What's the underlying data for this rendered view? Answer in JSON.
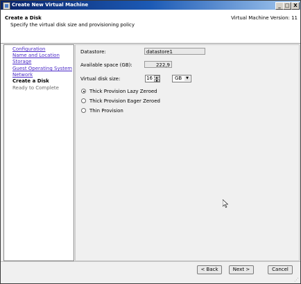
{
  "window": {
    "title": "Create New Virtual Machine",
    "controls": {
      "minimize": "_",
      "maximize": "□",
      "close": "X"
    }
  },
  "header": {
    "title": "Create a Disk",
    "subtitle": "Specify the virtual disk size and provisioning policy",
    "version": "Virtual Machine Version: 11"
  },
  "sidebar": {
    "steps": [
      {
        "label": "Configuration",
        "state": "link"
      },
      {
        "label": "Name and Location",
        "state": "link"
      },
      {
        "label": "Storage",
        "state": "link"
      },
      {
        "label": "Guest Operating System",
        "state": "link"
      },
      {
        "label": "Network",
        "state": "link"
      },
      {
        "label": "Create a Disk",
        "state": "current"
      },
      {
        "label": "Ready to Complete",
        "state": "pending"
      }
    ]
  },
  "form": {
    "datastore_label": "Datastore:",
    "datastore_value": "datastore1",
    "available_label": "Available space (GB):",
    "available_value": "222,9",
    "size_label": "Virtual disk size:",
    "size_value": "16",
    "size_unit": "GB",
    "provisioning": [
      {
        "label": "Thick Provision Lazy Zeroed",
        "checked": true
      },
      {
        "label": "Thick Provision Eager Zeroed",
        "checked": false
      },
      {
        "label": "Thin Provision",
        "checked": false
      }
    ]
  },
  "footer": {
    "back": "< Back",
    "next": "Next >",
    "cancel": "Cancel"
  }
}
